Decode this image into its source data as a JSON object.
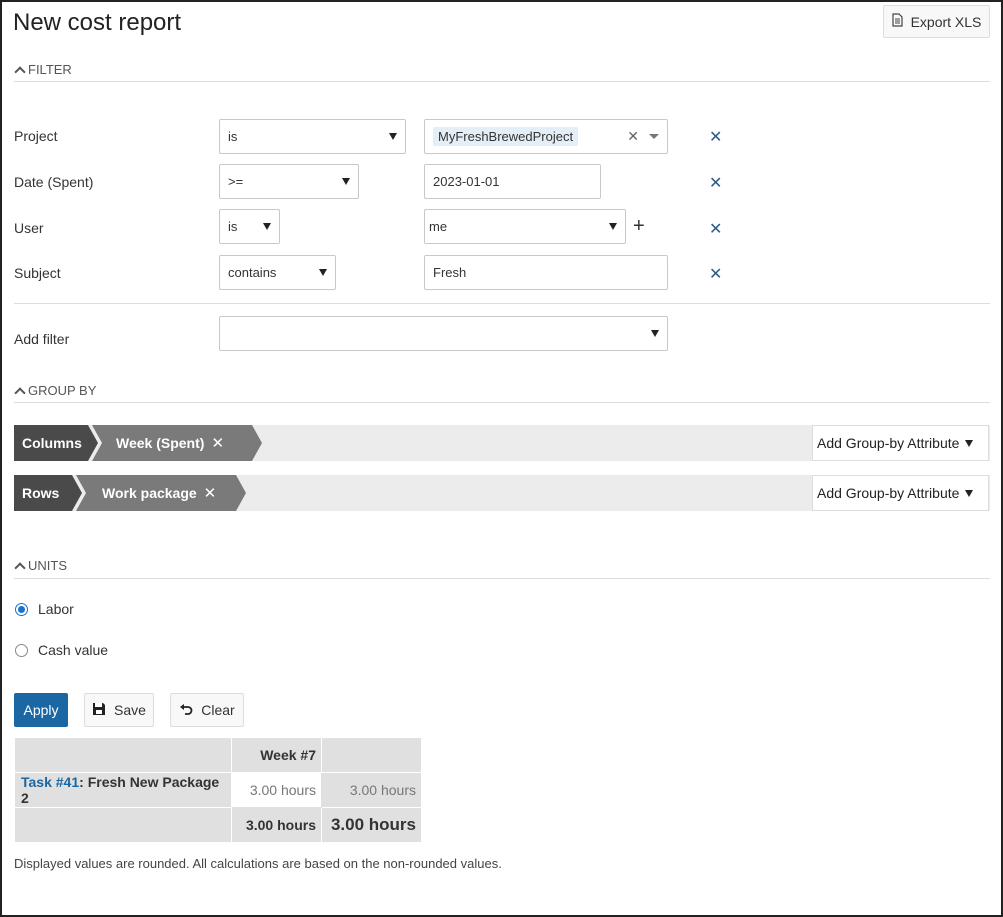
{
  "header": {
    "title": "New cost report",
    "export_label": "Export XLS"
  },
  "filter": {
    "section_label": "FILTER",
    "rows": [
      {
        "label": "Project",
        "operator": "is",
        "value": "MyFreshBrewedProject"
      },
      {
        "label": "Date (Spent)",
        "operator": ">=",
        "value": "2023-01-01"
      },
      {
        "label": "User",
        "operator": "is",
        "value": "me"
      },
      {
        "label": "Subject",
        "operator": "contains",
        "value": "Fresh"
      }
    ],
    "add_filter_label": "Add filter",
    "add_filter_value": ""
  },
  "group_by": {
    "section_label": "GROUP BY",
    "columns_label": "Columns",
    "columns_attr": "Week (Spent)",
    "rows_label": "Rows",
    "rows_attr": "Work package",
    "add_label": "Add Group-by Attribute"
  },
  "units": {
    "section_label": "UNITS",
    "options": [
      "Labor",
      "Cash value"
    ],
    "selected": "Labor"
  },
  "actions": {
    "apply": "Apply",
    "save": "Save",
    "clear": "Clear"
  },
  "report": {
    "column_header": "Week #7",
    "row_task_ref": "Task #41",
    "row_task_sep": ":",
    "row_task_name": "Fresh New Package 2",
    "row_value": "3.00 hours",
    "row_total": "3.00 hours",
    "col_total": "3.00 hours",
    "grand_total": "3.00 hours"
  },
  "footnote": "Displayed values are rounded. All calculations are based on the non-rounded values."
}
